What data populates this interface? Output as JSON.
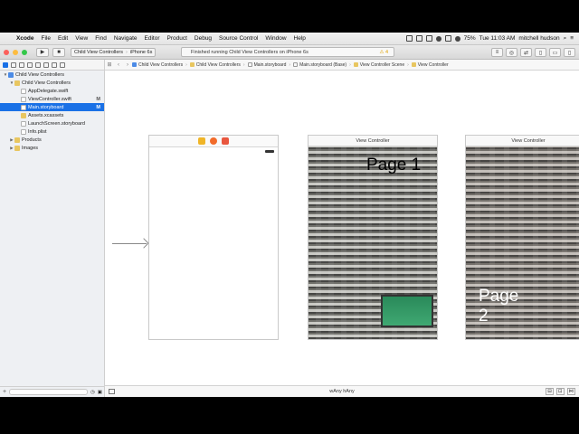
{
  "menubar": {
    "apple": "",
    "items": [
      "Xcode",
      "File",
      "Edit",
      "View",
      "Find",
      "Navigate",
      "Editor",
      "Product",
      "Debug",
      "Source Control",
      "Window",
      "Help"
    ],
    "battery": "75%",
    "clock": "Tue 11:03 AM",
    "user": "mitchell hudson"
  },
  "toolbar": {
    "run": "▶",
    "stop": "■",
    "scheme": "Child View Controllers",
    "device": "iPhone 6s",
    "activity": "Finished running Child View Controllers on iPhone 6s",
    "warning_count": "4"
  },
  "navigator": {
    "items": [
      {
        "label": "Child View Controllers",
        "kind": "proj",
        "depth": 0,
        "tri": "▼",
        "badge": ""
      },
      {
        "label": "Child View Controllers",
        "kind": "folder",
        "depth": 1,
        "tri": "▼",
        "badge": ""
      },
      {
        "label": "AppDelegate.swift",
        "kind": "file",
        "depth": 2,
        "tri": "",
        "badge": ""
      },
      {
        "label": "ViewController.swift",
        "kind": "file",
        "depth": 2,
        "tri": "",
        "badge": "M"
      },
      {
        "label": "Main.storyboard",
        "kind": "file",
        "depth": 2,
        "tri": "",
        "badge": "M",
        "selected": true
      },
      {
        "label": "Assets.xcassets",
        "kind": "folder",
        "depth": 2,
        "tri": "",
        "badge": ""
      },
      {
        "label": "LaunchScreen.storyboard",
        "kind": "file",
        "depth": 2,
        "tri": "",
        "badge": ""
      },
      {
        "label": "Info.plist",
        "kind": "file",
        "depth": 2,
        "tri": "",
        "badge": ""
      },
      {
        "label": "Products",
        "kind": "folder",
        "depth": 1,
        "tri": "▶",
        "badge": ""
      },
      {
        "label": "Images",
        "kind": "folder",
        "depth": 1,
        "tri": "▶",
        "badge": ""
      }
    ]
  },
  "jumpbar": {
    "crumbs": [
      "Child View Controllers",
      "Child View Controllers",
      "Main.storyboard",
      "Main.storyboard (Base)",
      "View Controller Scene",
      "View Controller"
    ]
  },
  "canvas": {
    "vc1_title": "View Controller",
    "vc2_title": "View Controller",
    "page1": "Page 1",
    "page2": "Page 2"
  },
  "bottombar": {
    "size_class": "wAny hAny"
  },
  "colors": {
    "selection": "#1a71e6",
    "close": "#fc605c",
    "minimize": "#fdbc40",
    "zoom": "#34c84a"
  }
}
